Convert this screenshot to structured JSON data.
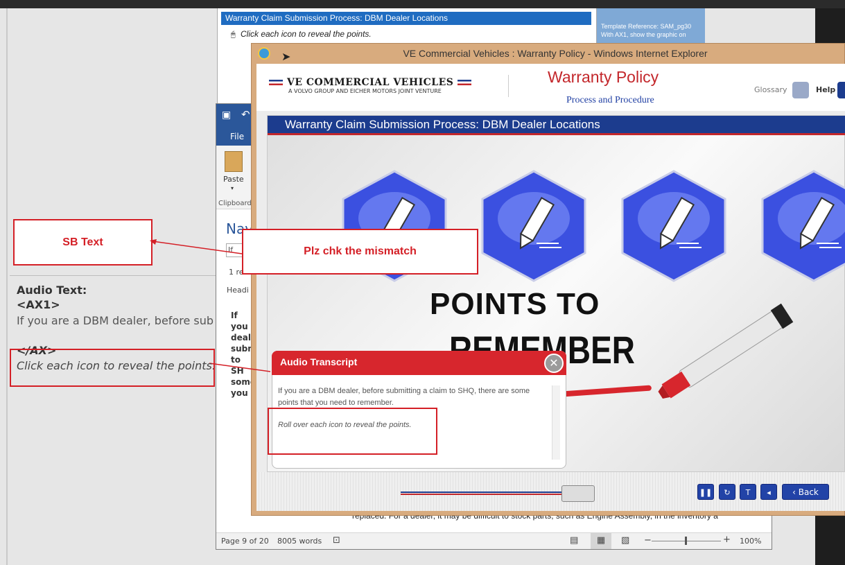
{
  "storyboard": {
    "bar_title": "Warranty Claim Submission Process: DBM Dealer Locations",
    "click_text": "Click each icon to reveal the points.",
    "note_line1": "Template Reference: SAM_pg30",
    "note_line2": "With AX1, show the graphic on"
  },
  "word": {
    "file_tab": "File",
    "paste_label": "Paste",
    "clipboard_label": "Clipboard",
    "nav_label": "Nav",
    "search_placeholder": "If yo",
    "result_count": "1 re",
    "heading_label": "Headi",
    "body_snip_1": "If you",
    "body_snip_2": "deale",
    "body_snip_3": "subm",
    "body_snip_4": "to SH",
    "body_snip_5": "some",
    "body_snip_6": "you",
    "body_bottom": "replaced. For a dealer, it may be difficult to stock parts, such as Engine Assembly, in the inventory a",
    "page_info": "Page 9 of 20",
    "word_count": "8005 words",
    "zoom": "100%"
  },
  "ie": {
    "window_title": "VE Commercial Vehicles : Warranty Policy - Windows Internet Explorer",
    "logo_main": "VE COMMERCIAL VEHICLES",
    "logo_sub": "A VOLVO GROUP AND EICHER MOTORS JOINT VENTURE",
    "course_title": "Warranty Policy",
    "course_subtitle": "Process and Procedure",
    "glossary_label": "Glossary",
    "help_label": "Help",
    "slide_title": "Warranty Claim Submission Process: DBM Dealer Locations",
    "points_to": "POINTS TO",
    "remember": "REMEMBER",
    "back_label": "Back"
  },
  "transcript": {
    "title": "Audio Transcript",
    "body": "If you are a DBM dealer, before submitting a claim to SHQ, there are some points that you need to remember.",
    "instruction": "Roll over each icon to reveal the points."
  },
  "annotations": {
    "sb_text": "SB Text",
    "mismatch": "Plz chk the mismatch",
    "audio_heading": "Audio Text:",
    "ax1_tag": "<AX1>",
    "ax1_line": "If you are a DBM dealer, before sub",
    "iax_tag": "</AX>",
    "click_line": "Click each icon to reveal the points."
  },
  "colors": {
    "brand_blue": "#1c3c8e",
    "brand_red": "#d7262d",
    "annotation_red": "#d41f26"
  }
}
